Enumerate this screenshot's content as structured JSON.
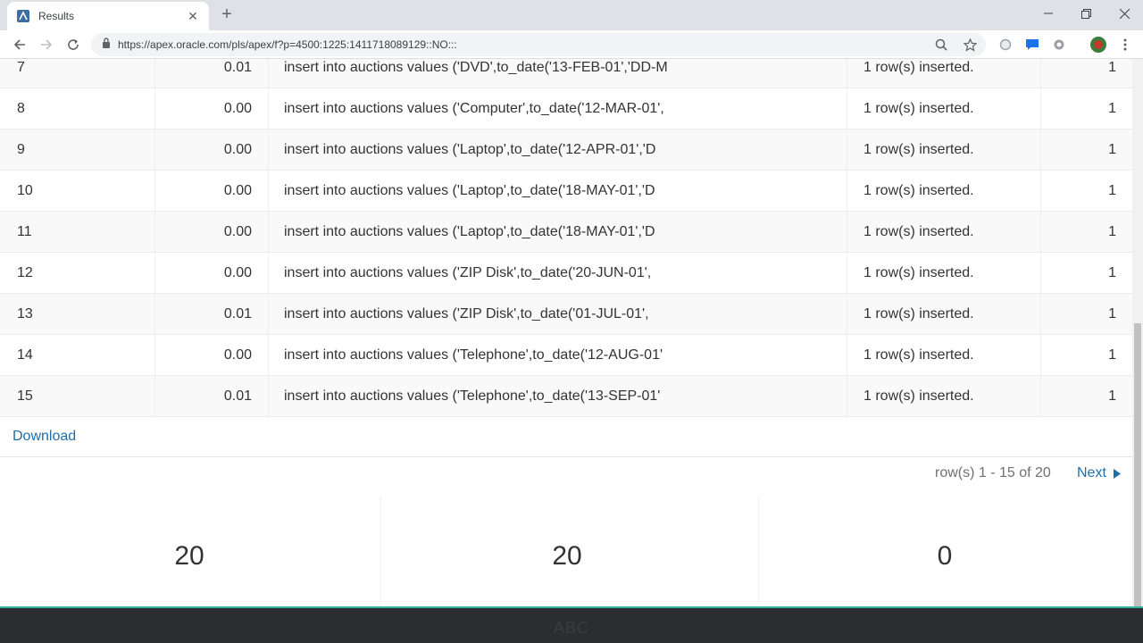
{
  "browser": {
    "tab_title": "Results",
    "url": "https://apex.oracle.com/pls/apex/f?p=4500:1225:1411718089129::NO:::"
  },
  "rows": [
    {
      "num": "7",
      "time": "0.01",
      "statement": "insert into auctions values ('DVD',to_date('13-FEB-01','DD-M",
      "result": "1 row(s) inserted.",
      "rows": "1"
    },
    {
      "num": "8",
      "time": "0.00",
      "statement": "insert into auctions values ('Computer',to_date('12-MAR-01',",
      "result": "1 row(s) inserted.",
      "rows": "1"
    },
    {
      "num": "9",
      "time": "0.00",
      "statement": "insert into auctions values ('Laptop',to_date('12-APR-01','D",
      "result": "1 row(s) inserted.",
      "rows": "1"
    },
    {
      "num": "10",
      "time": "0.00",
      "statement": "insert into auctions values ('Laptop',to_date('18-MAY-01','D",
      "result": "1 row(s) inserted.",
      "rows": "1"
    },
    {
      "num": "11",
      "time": "0.00",
      "statement": "insert into auctions values ('Laptop',to_date('18-MAY-01','D",
      "result": "1 row(s) inserted.",
      "rows": "1"
    },
    {
      "num": "12",
      "time": "0.00",
      "statement": "insert into auctions values ('ZIP Disk',to_date('20-JUN-01',",
      "result": "1 row(s) inserted.",
      "rows": "1"
    },
    {
      "num": "13",
      "time": "0.01",
      "statement": "insert into auctions values ('ZIP Disk',to_date('01-JUL-01',",
      "result": "1 row(s) inserted.",
      "rows": "1"
    },
    {
      "num": "14",
      "time": "0.00",
      "statement": "insert into auctions values ('Telephone',to_date('12-AUG-01'",
      "result": "1 row(s) inserted.",
      "rows": "1"
    },
    {
      "num": "15",
      "time": "0.01",
      "statement": "insert into auctions values ('Telephone',to_date('13-SEP-01'",
      "result": "1 row(s) inserted.",
      "rows": "1"
    }
  ],
  "download_label": "Download",
  "pagination": {
    "range_text": "row(s) 1 - 15 of 20",
    "next_label": "Next"
  },
  "stats": [
    "20",
    "20",
    "0"
  ],
  "footer_text": "ABC",
  "colors": {
    "link": "#1f6ea8",
    "footer_bg": "#2b2d30",
    "footer_accent": "#35b5a0"
  }
}
